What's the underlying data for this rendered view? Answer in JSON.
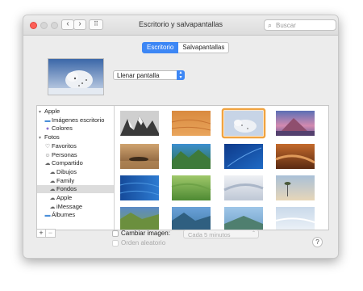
{
  "window": {
    "title": "Escritorio y salvapantallas",
    "search_placeholder": "Buscar",
    "back_icon": "‹",
    "forward_icon": "›",
    "grid_icon": "⠿"
  },
  "tabs": [
    {
      "label": "Escritorio",
      "selected": true
    },
    {
      "label": "Salvapantallas",
      "selected": false
    }
  ],
  "fit_select": {
    "value": "Llenar pantalla"
  },
  "sidebar": {
    "items": [
      {
        "label": "Apple",
        "icon": "disclosure-open",
        "indent": 0
      },
      {
        "label": "Imágenes escritorio",
        "icon": "folder-icon",
        "indent": 1
      },
      {
        "label": "Colores",
        "icon": "color-icon",
        "indent": 1
      },
      {
        "label": "Fotos",
        "icon": "disclosure-open",
        "indent": 0
      },
      {
        "label": "Favoritos",
        "icon": "heart-icon",
        "indent": 1
      },
      {
        "label": "Personas",
        "icon": "person-icon",
        "indent": 1
      },
      {
        "label": "Compartido",
        "icon": "cloud-icon",
        "indent": 1
      },
      {
        "label": "Dibujos",
        "icon": "cloud-icon",
        "indent": 2
      },
      {
        "label": "Family",
        "icon": "cloud-icon",
        "indent": 2
      },
      {
        "label": "Fondos",
        "icon": "cloud-icon",
        "indent": 2,
        "selected": true
      },
      {
        "label": "Apple",
        "icon": "cloud-icon",
        "indent": 2
      },
      {
        "label": "iMessage",
        "icon": "cloud-icon",
        "indent": 2
      },
      {
        "label": "Álbumes",
        "icon": "folder-icon",
        "indent": 1
      }
    ]
  },
  "bottom": {
    "add_label": "+",
    "remove_label": "−",
    "change_image_label": "Cambiar imagen:",
    "interval_value": "Cada 5 minutos",
    "random_order_label": "Orden aleatorio",
    "help_label": "?"
  },
  "colors": {
    "accent": "#3d87f5",
    "selection_outline": "#f0a340"
  }
}
